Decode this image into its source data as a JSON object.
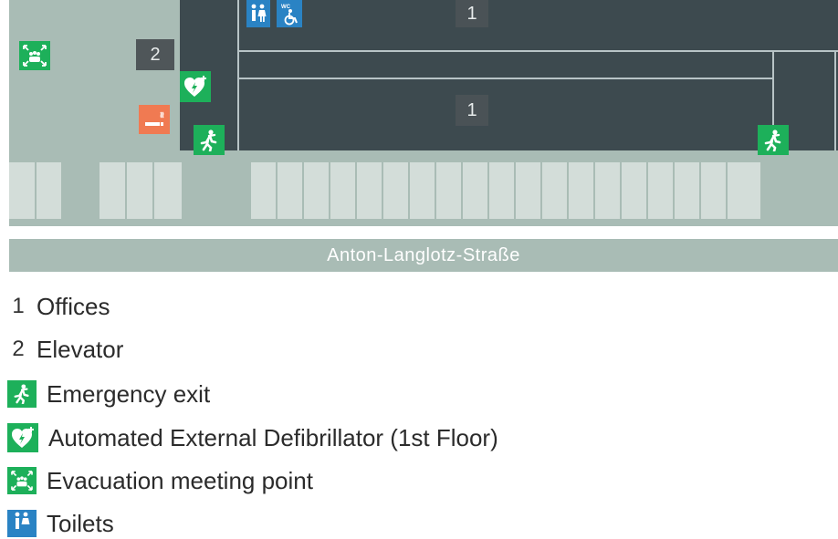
{
  "map": {
    "rooms": [
      {
        "number": "1",
        "role": "offices-upper"
      },
      {
        "number": "1",
        "role": "offices-lower"
      },
      {
        "number": "2",
        "role": "elevator"
      }
    ],
    "street_name": "Anton-Langlotz-Straße"
  },
  "legend": {
    "items": [
      {
        "symbol": "1",
        "label": "Offices",
        "icon": "number"
      },
      {
        "symbol": "2",
        "label": "Elevator",
        "icon": "number"
      },
      {
        "symbol": "",
        "label": "Emergency exit",
        "icon": "emergency-exit-icon"
      },
      {
        "symbol": "",
        "label": "Automated External Defibrillator (1st Floor)",
        "icon": "defibrillator-icon"
      },
      {
        "symbol": "",
        "label": "Evacuation meeting point",
        "icon": "evacuation-point-icon"
      },
      {
        "symbol": "",
        "label": "Toilets",
        "icon": "toilets-icon"
      }
    ]
  },
  "colors": {
    "map_background": "#a9bcb5",
    "building": "#3d4a4f",
    "parking": "#d3ddd9",
    "safety_green": "#1db05a",
    "info_blue": "#2a83c4",
    "smoking_orange": "#f07a52"
  }
}
